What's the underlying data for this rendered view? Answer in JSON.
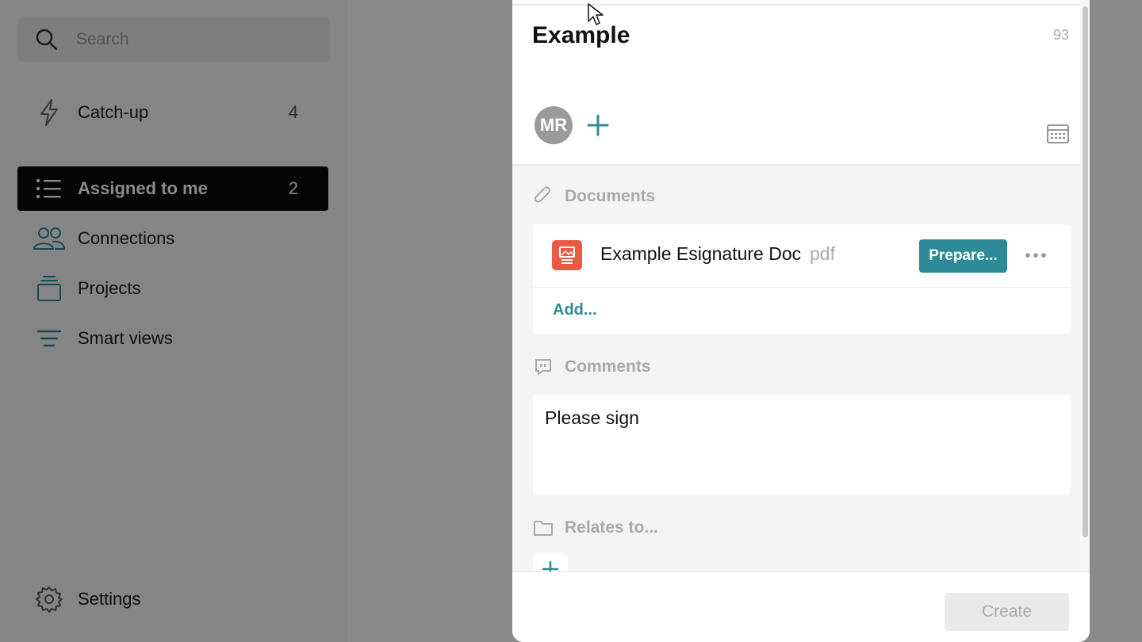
{
  "sidebar": {
    "search_placeholder": "Search",
    "items": [
      {
        "label": "Catch-up",
        "count": "4",
        "icon": "lightning-icon"
      },
      {
        "label": "Assigned to me",
        "count": "2",
        "icon": "list-icon"
      },
      {
        "label": "Connections",
        "icon": "people-icon"
      },
      {
        "label": "Projects",
        "icon": "stack-icon"
      },
      {
        "label": "Smart views",
        "icon": "filter-lines-icon"
      }
    ],
    "settings_label": "Settings"
  },
  "modal": {
    "title": "Example",
    "char_count": "93",
    "assignee_initials": "MR",
    "documents_label": "Documents",
    "document": {
      "name": "Example Esignature Doc",
      "ext": "pdf"
    },
    "prepare_label": "Prepare...",
    "add_label": "Add...",
    "comments_label": "Comments",
    "comment_text": "Please sign",
    "relates_label": "Relates to...",
    "create_label": "Create"
  },
  "colors": {
    "accent": "#2d8a96",
    "pdf_icon": "#ea5a47",
    "active_nav": "#0a0a0a"
  }
}
